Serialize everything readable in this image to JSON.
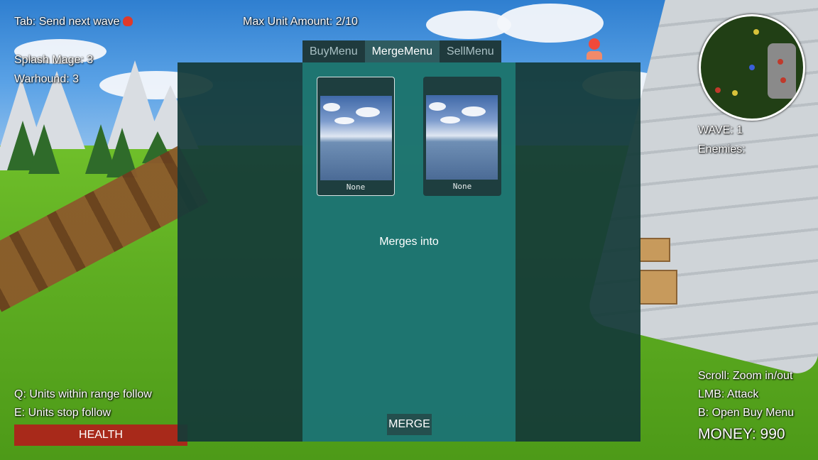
{
  "hud": {
    "send_wave": "Tab: Send next wave",
    "max_units": "Max Unit Amount: 2/10",
    "units": [
      {
        "label": "Splash Mage: 3"
      },
      {
        "label": "Warhound: 3"
      }
    ],
    "wave": "WAVE: 1",
    "enemies": "Enemies:",
    "follow": "Q: Units within range follow",
    "stop_follow": "E: Units stop follow",
    "health_label": "HEALTH",
    "scroll_hint": "Scroll: Zoom in/out",
    "attack_hint": "LMB: Attack",
    "buy_hint": "B: Open Buy Menu",
    "money": "MONEY: 990"
  },
  "menu": {
    "tabs": [
      {
        "label": "BuyMenu",
        "active": false
      },
      {
        "label": "MergeMenu",
        "active": true
      },
      {
        "label": "SellMenu",
        "active": false
      }
    ],
    "slots": [
      {
        "label": "None",
        "selected": true
      },
      {
        "label": "None",
        "selected": false
      }
    ],
    "merges_into": "Merges into",
    "merge_button": "MERGE"
  },
  "icons": {
    "skull": "skull-icon",
    "enemy": "enemy-marker-icon"
  },
  "colors": {
    "health": "#a8291a",
    "panel_outer": "#143a38",
    "panel_inner": "#1f7a74",
    "skull": "#e03a2a"
  }
}
